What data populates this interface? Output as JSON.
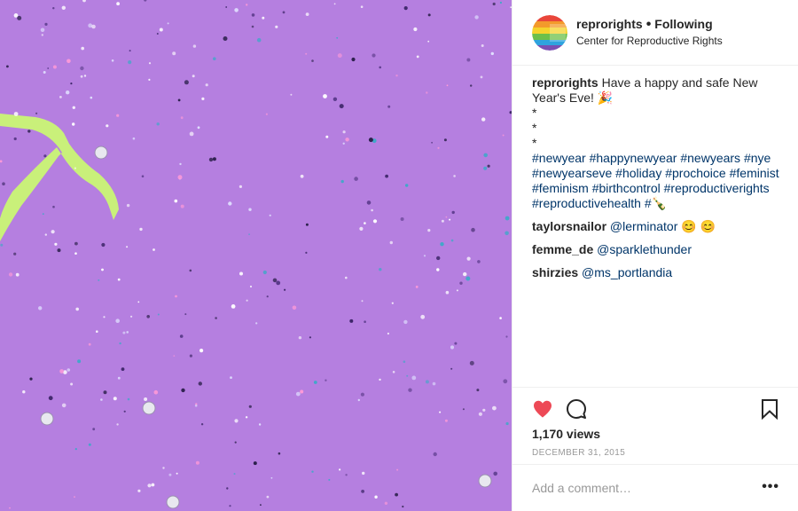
{
  "post": {
    "image_alt": "purple background with glitter and green IUD shape",
    "colors": {
      "background": "#b57fe0",
      "accent_shape": "#c9f07a",
      "heart": "#ed4956",
      "link": "#003569"
    }
  },
  "header": {
    "username": "reprorights",
    "separator": "•",
    "follow_status": "Following",
    "subtitle": "Center for Reproductive Rights"
  },
  "caption": {
    "username": "reprorights",
    "text_line1": "Have a happy and safe New Year's Eve! 🎉",
    "bullets": [
      "*",
      "*",
      "*"
    ],
    "hashtags": [
      "#newyear",
      "#happynewyear",
      "#newyears",
      "#nye",
      "#newyearseve",
      "#holiday",
      "#prochoice",
      "#feminist",
      "#feminism",
      "#birthcontrol",
      "#reproductiverights",
      "#reproductivehealth",
      "#🍾"
    ]
  },
  "comments": [
    {
      "username": "taylorsnailor",
      "text": "@lerminator 😊 😊"
    },
    {
      "username": "femme_de",
      "text": "@sparklethunder"
    },
    {
      "username": "shirzies",
      "text": "@ms_portlandia"
    }
  ],
  "actions": {
    "like_icon": "heart-filled-icon",
    "comment_icon": "comment-bubble-icon",
    "save_icon": "bookmark-icon",
    "views": "1,170 views",
    "date": "DECEMBER 31, 2015"
  },
  "add_comment": {
    "placeholder": "Add a comment…",
    "more_label": "•••"
  }
}
